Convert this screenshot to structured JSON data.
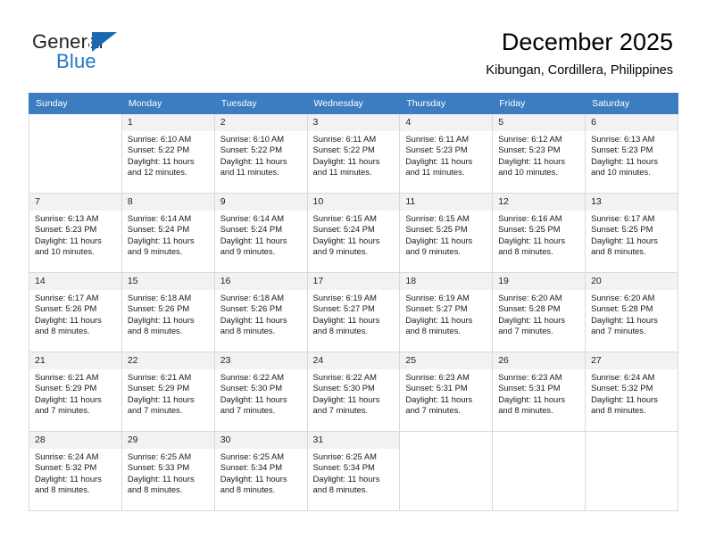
{
  "brand": {
    "name_top": "General",
    "name_bottom": "Blue",
    "accent_color": "#2076c4",
    "triangle_icon": "blue-triangle-icon"
  },
  "header": {
    "title": "December 2025",
    "subtitle": "Kibungan, Cordillera, Philippines"
  },
  "calendar": {
    "header_color": "#3b7dc0",
    "daynum_bg": "#f2f2f2",
    "weekday_headers": [
      "Sunday",
      "Monday",
      "Tuesday",
      "Wednesday",
      "Thursday",
      "Friday",
      "Saturday"
    ],
    "weeks": [
      [
        {
          "day": "",
          "blank": true
        },
        {
          "day": "1",
          "sunrise": "Sunrise: 6:10 AM",
          "sunset": "Sunset: 5:22 PM",
          "daylight": "Daylight: 11 hours and 12 minutes."
        },
        {
          "day": "2",
          "sunrise": "Sunrise: 6:10 AM",
          "sunset": "Sunset: 5:22 PM",
          "daylight": "Daylight: 11 hours and 11 minutes."
        },
        {
          "day": "3",
          "sunrise": "Sunrise: 6:11 AM",
          "sunset": "Sunset: 5:22 PM",
          "daylight": "Daylight: 11 hours and 11 minutes."
        },
        {
          "day": "4",
          "sunrise": "Sunrise: 6:11 AM",
          "sunset": "Sunset: 5:23 PM",
          "daylight": "Daylight: 11 hours and 11 minutes."
        },
        {
          "day": "5",
          "sunrise": "Sunrise: 6:12 AM",
          "sunset": "Sunset: 5:23 PM",
          "daylight": "Daylight: 11 hours and 10 minutes."
        },
        {
          "day": "6",
          "sunrise": "Sunrise: 6:13 AM",
          "sunset": "Sunset: 5:23 PM",
          "daylight": "Daylight: 11 hours and 10 minutes."
        }
      ],
      [
        {
          "day": "7",
          "sunrise": "Sunrise: 6:13 AM",
          "sunset": "Sunset: 5:23 PM",
          "daylight": "Daylight: 11 hours and 10 minutes."
        },
        {
          "day": "8",
          "sunrise": "Sunrise: 6:14 AM",
          "sunset": "Sunset: 5:24 PM",
          "daylight": "Daylight: 11 hours and 9 minutes."
        },
        {
          "day": "9",
          "sunrise": "Sunrise: 6:14 AM",
          "sunset": "Sunset: 5:24 PM",
          "daylight": "Daylight: 11 hours and 9 minutes."
        },
        {
          "day": "10",
          "sunrise": "Sunrise: 6:15 AM",
          "sunset": "Sunset: 5:24 PM",
          "daylight": "Daylight: 11 hours and 9 minutes."
        },
        {
          "day": "11",
          "sunrise": "Sunrise: 6:15 AM",
          "sunset": "Sunset: 5:25 PM",
          "daylight": "Daylight: 11 hours and 9 minutes."
        },
        {
          "day": "12",
          "sunrise": "Sunrise: 6:16 AM",
          "sunset": "Sunset: 5:25 PM",
          "daylight": "Daylight: 11 hours and 8 minutes."
        },
        {
          "day": "13",
          "sunrise": "Sunrise: 6:17 AM",
          "sunset": "Sunset: 5:25 PM",
          "daylight": "Daylight: 11 hours and 8 minutes."
        }
      ],
      [
        {
          "day": "14",
          "sunrise": "Sunrise: 6:17 AM",
          "sunset": "Sunset: 5:26 PM",
          "daylight": "Daylight: 11 hours and 8 minutes."
        },
        {
          "day": "15",
          "sunrise": "Sunrise: 6:18 AM",
          "sunset": "Sunset: 5:26 PM",
          "daylight": "Daylight: 11 hours and 8 minutes."
        },
        {
          "day": "16",
          "sunrise": "Sunrise: 6:18 AM",
          "sunset": "Sunset: 5:26 PM",
          "daylight": "Daylight: 11 hours and 8 minutes."
        },
        {
          "day": "17",
          "sunrise": "Sunrise: 6:19 AM",
          "sunset": "Sunset: 5:27 PM",
          "daylight": "Daylight: 11 hours and 8 minutes."
        },
        {
          "day": "18",
          "sunrise": "Sunrise: 6:19 AM",
          "sunset": "Sunset: 5:27 PM",
          "daylight": "Daylight: 11 hours and 8 minutes."
        },
        {
          "day": "19",
          "sunrise": "Sunrise: 6:20 AM",
          "sunset": "Sunset: 5:28 PM",
          "daylight": "Daylight: 11 hours and 7 minutes."
        },
        {
          "day": "20",
          "sunrise": "Sunrise: 6:20 AM",
          "sunset": "Sunset: 5:28 PM",
          "daylight": "Daylight: 11 hours and 7 minutes."
        }
      ],
      [
        {
          "day": "21",
          "sunrise": "Sunrise: 6:21 AM",
          "sunset": "Sunset: 5:29 PM",
          "daylight": "Daylight: 11 hours and 7 minutes."
        },
        {
          "day": "22",
          "sunrise": "Sunrise: 6:21 AM",
          "sunset": "Sunset: 5:29 PM",
          "daylight": "Daylight: 11 hours and 7 minutes."
        },
        {
          "day": "23",
          "sunrise": "Sunrise: 6:22 AM",
          "sunset": "Sunset: 5:30 PM",
          "daylight": "Daylight: 11 hours and 7 minutes."
        },
        {
          "day": "24",
          "sunrise": "Sunrise: 6:22 AM",
          "sunset": "Sunset: 5:30 PM",
          "daylight": "Daylight: 11 hours and 7 minutes."
        },
        {
          "day": "25",
          "sunrise": "Sunrise: 6:23 AM",
          "sunset": "Sunset: 5:31 PM",
          "daylight": "Daylight: 11 hours and 7 minutes."
        },
        {
          "day": "26",
          "sunrise": "Sunrise: 6:23 AM",
          "sunset": "Sunset: 5:31 PM",
          "daylight": "Daylight: 11 hours and 8 minutes."
        },
        {
          "day": "27",
          "sunrise": "Sunrise: 6:24 AM",
          "sunset": "Sunset: 5:32 PM",
          "daylight": "Daylight: 11 hours and 8 minutes."
        }
      ],
      [
        {
          "day": "28",
          "sunrise": "Sunrise: 6:24 AM",
          "sunset": "Sunset: 5:32 PM",
          "daylight": "Daylight: 11 hours and 8 minutes."
        },
        {
          "day": "29",
          "sunrise": "Sunrise: 6:25 AM",
          "sunset": "Sunset: 5:33 PM",
          "daylight": "Daylight: 11 hours and 8 minutes."
        },
        {
          "day": "30",
          "sunrise": "Sunrise: 6:25 AM",
          "sunset": "Sunset: 5:34 PM",
          "daylight": "Daylight: 11 hours and 8 minutes."
        },
        {
          "day": "31",
          "sunrise": "Sunrise: 6:25 AM",
          "sunset": "Sunset: 5:34 PM",
          "daylight": "Daylight: 11 hours and 8 minutes."
        },
        {
          "day": "",
          "blank": true
        },
        {
          "day": "",
          "blank": true
        },
        {
          "day": "",
          "blank": true
        }
      ]
    ]
  }
}
